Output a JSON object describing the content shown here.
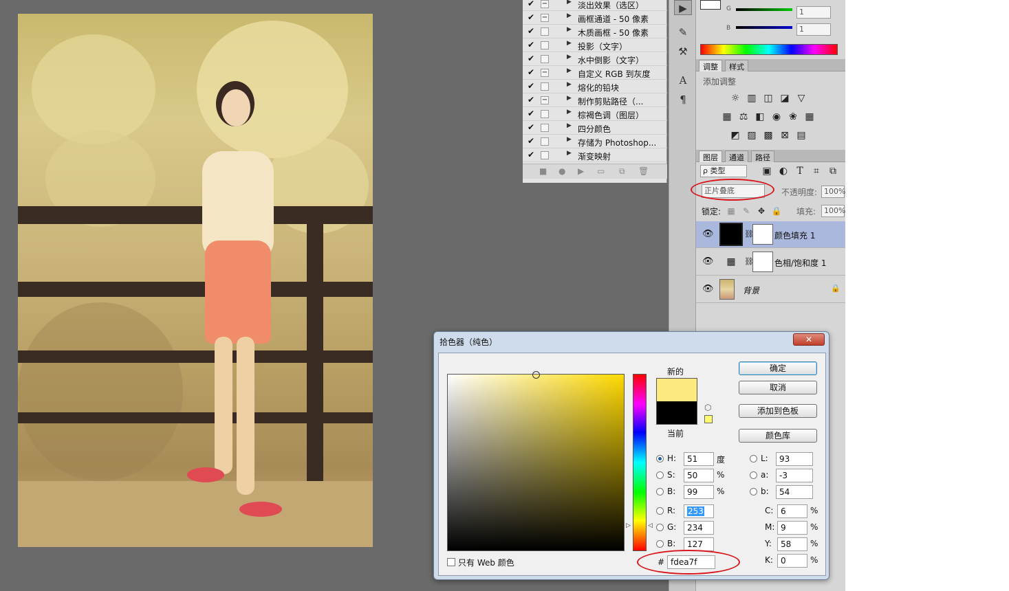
{
  "actions": {
    "items": [
      {
        "label": "淡出效果（选区）",
        "checked": true,
        "has_dialog": true
      },
      {
        "label": "画框通道 - 50 像素",
        "checked": true,
        "has_dialog": true
      },
      {
        "label": "木质画框 - 50 像素",
        "checked": true,
        "has_dialog": false
      },
      {
        "label": "投影（文字）",
        "checked": true,
        "has_dialog": false
      },
      {
        "label": "水中倒影（文字）",
        "checked": true,
        "has_dialog": false
      },
      {
        "label": "自定义 RGB 到灰度",
        "checked": true,
        "has_dialog": true
      },
      {
        "label": "熔化的铅块",
        "checked": true,
        "has_dialog": false
      },
      {
        "label": "制作剪贴路径（...",
        "checked": true,
        "has_dialog": true
      },
      {
        "label": "棕褐色调（图层）",
        "checked": true,
        "has_dialog": false
      },
      {
        "label": "四分颜色",
        "checked": true,
        "has_dialog": false
      },
      {
        "label": "存储为 Photoshop...",
        "checked": true,
        "has_dialog": false
      },
      {
        "label": "渐变映射",
        "checked": true,
        "has_dialog": false
      }
    ],
    "check_glyph": "✔",
    "dialog_glyph": "−",
    "expand_glyph": "▶",
    "footer_icons": [
      "■",
      "●",
      "▶",
      "▭",
      "⧉",
      "🗑"
    ]
  },
  "color_panel": {
    "g_label": "G",
    "g_value": "1",
    "b_label": "B",
    "b_value": "1"
  },
  "adjustments": {
    "tabs": [
      "调整",
      "样式"
    ],
    "add_label": "添加调整"
  },
  "layers": {
    "tabs": [
      "图层",
      "通道",
      "路径"
    ],
    "filter_label": "ρ 类型",
    "blend_mode": "正片叠底",
    "opacity_label": "不透明度:",
    "opacity_value": "100%",
    "lock_label": "锁定:",
    "fill_label": "填充:",
    "fill_value": "100%",
    "items": [
      {
        "name": "颜色填充 1",
        "selected": true
      },
      {
        "name": "色相/饱和度 1",
        "selected": false
      },
      {
        "name": "背景",
        "selected": false
      }
    ]
  },
  "picker": {
    "title": "拾色器（纯色）",
    "close_label": "✕",
    "new_label": "新的",
    "current_label": "当前",
    "new_color": "#fdea7f",
    "current_color": "#000000",
    "ok_label": "确定",
    "cancel_label": "取消",
    "add_swatch_label": "添加到色板",
    "library_label": "颜色库",
    "fields": {
      "H": {
        "label": "H:",
        "value": "51",
        "unit": "度"
      },
      "S": {
        "label": "S:",
        "value": "50",
        "unit": "%"
      },
      "Bv": {
        "label": "B:",
        "value": "99",
        "unit": "%"
      },
      "R": {
        "label": "R:",
        "value": "253",
        "unit": ""
      },
      "G": {
        "label": "G:",
        "value": "234",
        "unit": ""
      },
      "Bc": {
        "label": "B:",
        "value": "127",
        "unit": ""
      },
      "L": {
        "label": "L:",
        "value": "93",
        "unit": ""
      },
      "a": {
        "label": "a:",
        "value": "-3",
        "unit": ""
      },
      "b": {
        "label": "b:",
        "value": "54",
        "unit": ""
      },
      "C": {
        "label": "C:",
        "value": "6",
        "unit": "%"
      },
      "M": {
        "label": "M:",
        "value": "9",
        "unit": "%"
      },
      "Y": {
        "label": "Y:",
        "value": "58",
        "unit": "%"
      },
      "K": {
        "label": "K:",
        "value": "0",
        "unit": "%"
      }
    },
    "web_only_label": "只有 Web 颜色",
    "hex_label": "#",
    "hex_value": "fdea7f"
  },
  "colors": {
    "highlight": "#d9161c",
    "selected_layer": "#a9b8dc"
  }
}
